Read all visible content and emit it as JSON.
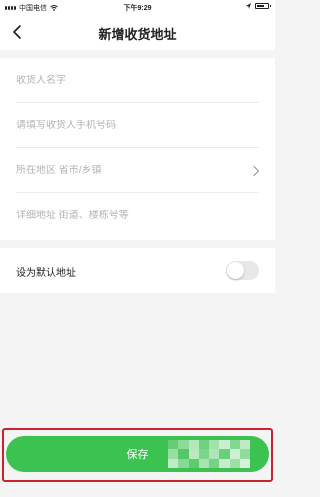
{
  "status_bar": {
    "carrier": "中国电信",
    "time": "下午9:29",
    "icons": [
      "signal-icon",
      "wifi-icon",
      "location-icon",
      "battery-icon"
    ]
  },
  "nav": {
    "title": "新增收货地址",
    "back_icon": "chevron-left-icon"
  },
  "form": {
    "fields": [
      {
        "placeholder": "收货人名字",
        "value": ""
      },
      {
        "placeholder": "请填写收货人手机号码",
        "value": ""
      },
      {
        "placeholder": "所在地区 省市/乡镇",
        "value": ""
      },
      {
        "placeholder": "详细地址 街道、楼栋号等",
        "value": ""
      }
    ],
    "region_chevron_icon": "chevron-right-icon"
  },
  "default_address": {
    "label": "设为默认地址",
    "enabled": false
  },
  "save_button": {
    "label": "保存"
  },
  "colors": {
    "accent_green": "#3cc251",
    "highlight_red": "#c8242b",
    "toggle_off": "#e8e8e8"
  }
}
